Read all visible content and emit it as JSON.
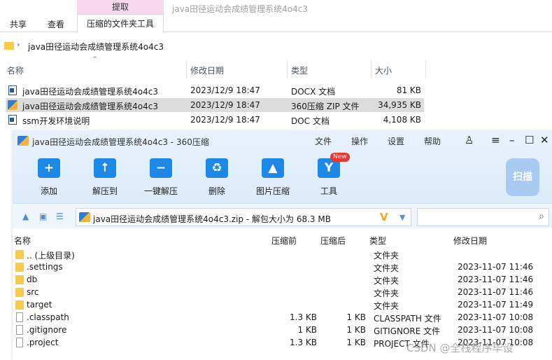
{
  "explorer": {
    "context_tab": "提取",
    "window_title": "java田径运动会成绩管理系统4o4c3",
    "tabs": [
      "共享",
      "查看",
      "压缩的文件夹工具"
    ],
    "address_path": "java田径运动会成绩管理系统4o4c3",
    "columns": [
      "名称",
      "修改日期",
      "类型",
      "大小"
    ],
    "files": [
      {
        "name": "java田径运动会成绩管理系统4o4c3",
        "date": "2023/12/9 18:47",
        "type": "DOCX 文档",
        "size": "81 KB",
        "icon": "word-doc-icon"
      },
      {
        "name": "java田径运动会成绩管理系统4o4c3",
        "date": "2023/12/9 18:47",
        "type": "360压缩 ZIP 文件",
        "size": "34,935 KB",
        "icon": "zip-archive-icon",
        "selected": true
      },
      {
        "name": "ssm开发环境说明",
        "date": "2023/12/9 18:47",
        "type": "DOC 文档",
        "size": "4,108 KB",
        "icon": "word-doc-icon"
      }
    ]
  },
  "zip_window": {
    "title": "java田径运动会成绩管理系统4o4c3 - 360压缩",
    "menu": [
      "文件",
      "操作",
      "设置",
      "帮助"
    ],
    "tools": [
      "添加",
      "解压到",
      "一键解压",
      "删除",
      "图片压缩",
      "工具"
    ],
    "new_badge": "New",
    "scan_label": "扫描",
    "path_text": "java田径运动会成绩管理系统4o4c3.zip - 解包大小为 68.3 MB",
    "columns": [
      "名称",
      "压缩前",
      "压缩后",
      "类型",
      "修改日期"
    ],
    "rows": [
      {
        "name": ".. (上级目录)",
        "before": "",
        "after": "",
        "type": "文件夹",
        "date": "",
        "kind": "folder"
      },
      {
        "name": ".settings",
        "before": "",
        "after": "",
        "type": "文件夹",
        "date": "2023-11-07 11:46",
        "kind": "folder"
      },
      {
        "name": "db",
        "before": "",
        "after": "",
        "type": "文件夹",
        "date": "2023-11-07 11:46",
        "kind": "folder"
      },
      {
        "name": "src",
        "before": "",
        "after": "",
        "type": "文件夹",
        "date": "2023-11-07 11:46",
        "kind": "folder"
      },
      {
        "name": "target",
        "before": "",
        "after": "",
        "type": "文件夹",
        "date": "2023-11-07 11:49",
        "kind": "folder"
      },
      {
        "name": ".classpath",
        "before": "1.3 KB",
        "after": "1 KB",
        "type": "CLASSPATH 文件",
        "date": "2023-11-07 10:08",
        "kind": "file"
      },
      {
        "name": ".gitignore",
        "before": "1 KB",
        "after": "1 KB",
        "type": "GITIGNORE 文件",
        "date": "2023-11-07 10:08",
        "kind": "file"
      },
      {
        "name": ".project",
        "before": "1.3 KB",
        "after": "1 KB",
        "type": "PROJECT 文件",
        "date": "2023-11-07 10:08",
        "kind": "file"
      }
    ]
  },
  "watermark": "CSDN @全栈程序毕设"
}
